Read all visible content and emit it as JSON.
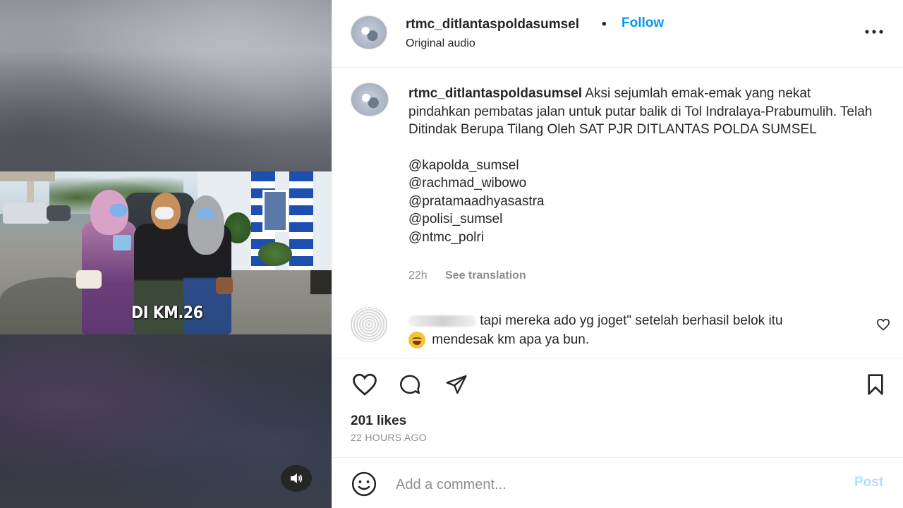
{
  "video": {
    "caption_overlay": "DI KM.26",
    "audio_button_icon": "speaker-icon"
  },
  "header": {
    "username": "rtmc_ditlantaspoldasumsel",
    "separator": "•",
    "follow_label": "Follow",
    "audio_label": "Original audio",
    "more_icon": "more-options-icon"
  },
  "caption": {
    "username": "rtmc_ditlantaspoldasumsel",
    "text": "Aksi sejumlah emak-emak yang nekat pindahkan pembatas jalan untuk putar balik di Tol Indralaya-Prabumulih. Telah Ditindak Berupa Tilang Oleh SAT PJR DITLANTAS POLDA SUMSEL",
    "mentions": [
      "@kapolda_sumsel",
      "@rachmad_wibowo",
      "@pratamaadhyasastra",
      "@polisi_sumsel",
      "@ntmc_polri"
    ],
    "time": "22h",
    "see_translation": "See translation"
  },
  "comment": {
    "text_line1": "tapi mereka ado yg joget\" setelah berhasil belok itu",
    "text_line2": "mendesak km apa ya bun."
  },
  "actions": {
    "like_icon": "heart-icon",
    "comment_icon": "comment-icon",
    "share_icon": "send-icon",
    "save_icon": "bookmark-icon"
  },
  "stats": {
    "likes": "201 likes",
    "time_ago": "22 HOURS AGO"
  },
  "add_comment": {
    "placeholder": "Add a comment...",
    "post_label": "Post"
  },
  "colors": {
    "accent": "#0095f6",
    "post_disabled": "#b2dffc",
    "muted_text": "#8e8e8e",
    "text": "#262626"
  }
}
